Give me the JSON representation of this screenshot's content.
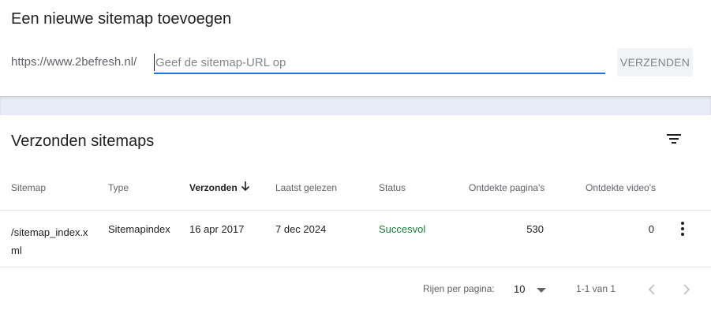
{
  "add_sitemap": {
    "title": "Een nieuwe sitemap toevoegen",
    "url_prefix": "https://www.2befresh.nl/",
    "input_placeholder": "Geef de sitemap-URL op",
    "input_value": "",
    "submit_label": "VERZENDEN"
  },
  "submitted": {
    "title": "Verzonden sitemaps",
    "filter_icon": "filter-list-icon",
    "columns": [
      "Sitemap",
      "Type",
      "Verzonden",
      "Laatst gelezen",
      "Status",
      "Ontdekte pagina's",
      "Ontdekte video's"
    ],
    "sorted_column": "Verzonden",
    "rows": [
      {
        "sitemap_line1": "/sitemap_index.x",
        "sitemap_line2": "ml",
        "type": "Sitemapindex",
        "submitted": "16 apr 2017",
        "last_read": "7 dec 2024",
        "status": "Succesvol",
        "pages": "530",
        "videos": "0"
      }
    ],
    "pagination": {
      "rows_per_page_label": "Rijen per pagina:",
      "rows_per_page": "10",
      "range": "1-1 van 1"
    }
  },
  "colors": {
    "accent": "#1a73e8",
    "success": "#188038",
    "divider": "#e8ecf6"
  }
}
